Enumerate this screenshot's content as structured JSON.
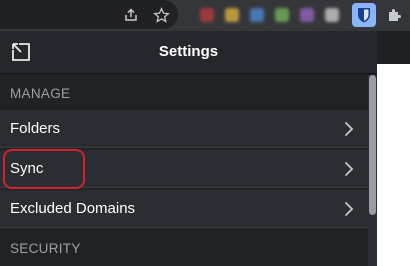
{
  "header": {
    "title": "Settings",
    "popout_icon": "popout-icon"
  },
  "sections": [
    {
      "label": "MANAGE",
      "items": [
        {
          "label": "Folders",
          "icon": "chevron-right-icon"
        },
        {
          "label": "Sync",
          "icon": "chevron-right-icon"
        },
        {
          "label": "Excluded Domains",
          "icon": "chevron-right-icon"
        }
      ]
    },
    {
      "label": "SECURITY",
      "items": []
    }
  ],
  "toolbar": {
    "icons": [
      "share-icon",
      "star-icon",
      "bitwarden-extension-icon",
      "extensions-puzzle-icon"
    ]
  },
  "colors": {
    "popup_bg": "#202326",
    "row_bg": "#2a2d31",
    "highlight": "#d0232b",
    "bitwarden_accent": "#8ab4f8"
  }
}
